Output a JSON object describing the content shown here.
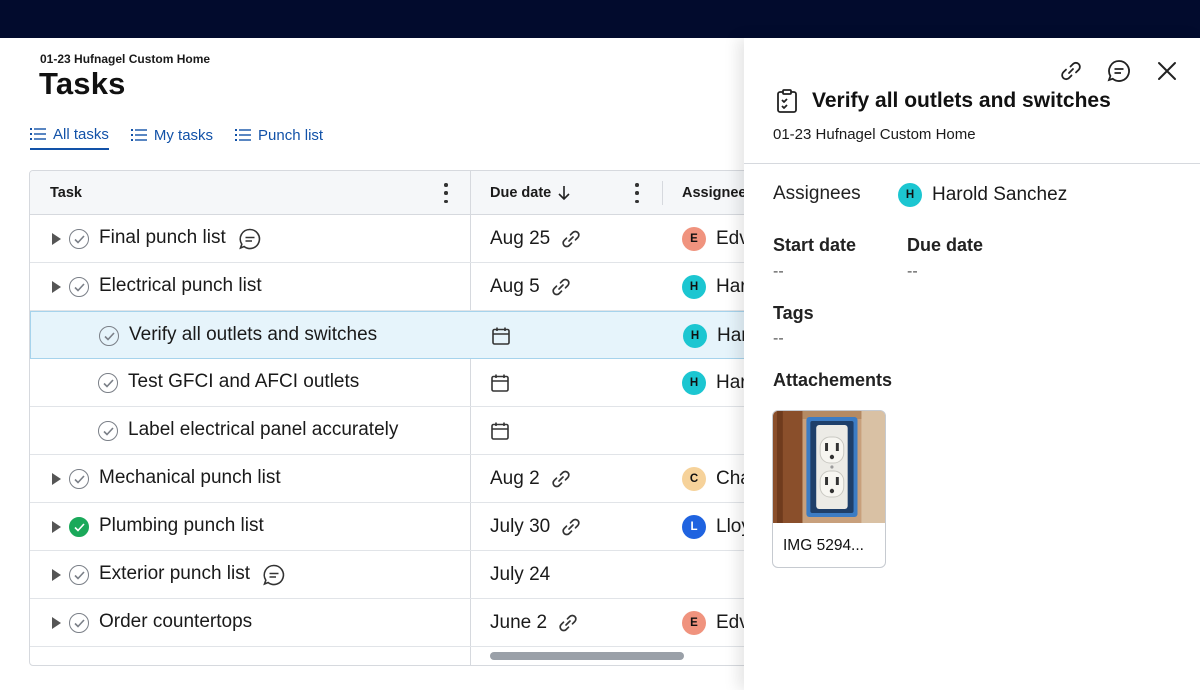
{
  "project_name": "01-23 Hufnagel Custom Home",
  "page_title": "Tasks",
  "tabs": [
    {
      "label": "All tasks",
      "active": true
    },
    {
      "label": "My tasks",
      "active": false
    },
    {
      "label": "Punch list",
      "active": false
    }
  ],
  "table": {
    "columns": {
      "task": "Task",
      "due": "Due date",
      "assignee": "Assignee"
    },
    "rows": [
      {
        "task": "Final punch list",
        "due": "Aug 25",
        "assignee": "Edv",
        "avatar": "E",
        "avatar_color": "#f0937e",
        "expandable": true,
        "completed": false,
        "has_comment": true,
        "has_link": true
      },
      {
        "task": "Electrical punch list",
        "due": "Aug 5",
        "assignee": "Har",
        "avatar": "H",
        "avatar_color": "#1cc6d1",
        "expandable": true,
        "completed": false,
        "has_comment": false,
        "has_link": true
      },
      {
        "task": "Verify all outlets and switches",
        "due": "",
        "assignee": "Har",
        "avatar": "H",
        "avatar_color": "#1cc6d1",
        "expandable": false,
        "completed": false,
        "selected": true,
        "calendar": true
      },
      {
        "task": "Test GFCI and AFCI outlets",
        "due": "",
        "assignee": "Har",
        "avatar": "H",
        "avatar_color": "#1cc6d1",
        "expandable": false,
        "completed": false,
        "calendar": true
      },
      {
        "task": "Label electrical panel accurately",
        "due": "",
        "assignee": "",
        "avatar": "",
        "expandable": false,
        "completed": false,
        "calendar": true
      },
      {
        "task": "Mechanical punch list",
        "due": "Aug 2",
        "assignee": "Cha",
        "avatar": "C",
        "avatar_color": "#f6d29a",
        "expandable": true,
        "completed": false,
        "has_link": true
      },
      {
        "task": "Plumbing punch list",
        "due": "July 30",
        "assignee": "Lloy",
        "avatar": "L",
        "avatar_color": "#1f63e0",
        "expandable": true,
        "completed": true,
        "has_link": true
      },
      {
        "task": "Exterior punch list",
        "due": "July 24",
        "assignee": "",
        "avatar": "",
        "expandable": true,
        "completed": false,
        "has_comment": true
      },
      {
        "task": "Order countertops",
        "due": "June 2",
        "assignee": "Edv",
        "avatar": "E",
        "avatar_color": "#f0937e",
        "expandable": true,
        "completed": false,
        "has_link": true
      }
    ]
  },
  "panel": {
    "title": "Verify all outlets and switches",
    "project": "01-23 Hufnagel Custom Home",
    "assignees_label": "Assignees",
    "assignee_name": "Harold Sanchez",
    "assignee_initial": "H",
    "start_date_label": "Start date",
    "start_date_value": "--",
    "due_date_label": "Due date",
    "due_date_value": "--",
    "tags_label": "Tags",
    "tags_value": "--",
    "attachments_label": "Attachements",
    "attachment_name": "IMG 5294..."
  },
  "colors": {
    "topbar": "#020b2d",
    "link_blue": "#1252a8",
    "selected_row": "#e6f4fb",
    "done_green": "#1aa95a"
  }
}
